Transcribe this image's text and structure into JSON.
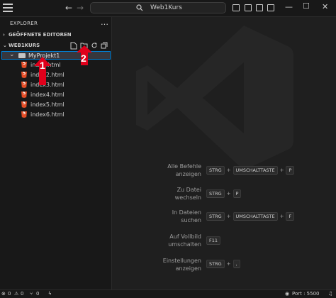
{
  "titlebar": {
    "search_text": "Web1Kurs"
  },
  "sidebar": {
    "title": "EXPLORER",
    "open_editors": "GEÖFFNETE EDITOREN",
    "workspace": "WEB1KURS",
    "folder": "MyProjekt1",
    "files": [
      "index.html",
      "index2.html",
      "index3.html",
      "index4.html",
      "index5.html",
      "index6.html"
    ]
  },
  "annotations": {
    "one": "1",
    "two": "2",
    "arrow_color": "#e0001b"
  },
  "shortcuts": [
    {
      "label_line1": "Alle Befehle",
      "label_line2": "anzeigen",
      "keys": [
        "STRG",
        "UMSCHALTTASTE",
        "P"
      ]
    },
    {
      "label_line1": "Zu Datei",
      "label_line2": "wechseln",
      "keys": [
        "STRG",
        "P"
      ]
    },
    {
      "label_line1": "In Dateien",
      "label_line2": "suchen",
      "keys": [
        "STRG",
        "UMSCHALTTASTE",
        "F"
      ]
    },
    {
      "label_line1": "Auf Vollbild",
      "label_line2": "umschalten",
      "keys": [
        "F11"
      ]
    },
    {
      "label_line1": "Einstellungen",
      "label_line2": "anzeigen",
      "keys": [
        "STRG",
        ","
      ]
    }
  ],
  "statusbar": {
    "errors": "0",
    "warnings": "0",
    "ports": "0",
    "port_label": "Port : 5500"
  }
}
